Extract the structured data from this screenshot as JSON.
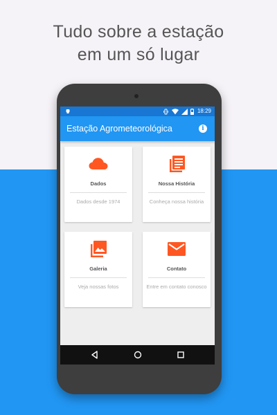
{
  "headline": {
    "line1": "Tudo sobre a estação",
    "line2": "em um só lugar"
  },
  "status_bar": {
    "time": "18:29"
  },
  "app_bar": {
    "title": "Estação Agrometeorológica",
    "info_icon": "info-icon"
  },
  "cards": [
    {
      "label": "Dados",
      "description": "Dados desde 1974",
      "icon": "cloud-icon"
    },
    {
      "label": "Nossa História",
      "description": "Conheça nossa história",
      "icon": "document-stack-icon"
    },
    {
      "label": "Galeria",
      "description": "Veja nossas fotos",
      "icon": "photo-gallery-icon"
    },
    {
      "label": "Contato",
      "description": "Entre em contato conosco",
      "icon": "envelope-icon"
    }
  ],
  "nav_bar": {
    "back": "back-triangle-icon",
    "home": "home-circle-icon",
    "recents": "recents-square-icon"
  },
  "colors": {
    "primary": "#2196f3",
    "primary_dark": "#1976d2",
    "accent": "#ff5722",
    "background": "#eeeeee"
  }
}
